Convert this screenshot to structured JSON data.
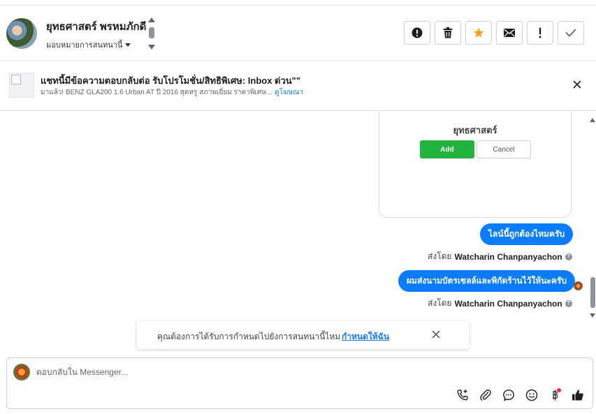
{
  "header": {
    "contact_name": "ยุทธศาสตร์ พรหมภักดี",
    "assign_label": "มอบหมายการสนทนานี้",
    "action_buttons": [
      {
        "name": "spam-button",
        "icon": "alert-circle-icon"
      },
      {
        "name": "delete-button",
        "icon": "trash-icon"
      },
      {
        "name": "star-button",
        "icon": "star-icon"
      },
      {
        "name": "mark-unread-button",
        "icon": "envelope-icon"
      },
      {
        "name": "follow-up-button",
        "icon": "exclamation-icon"
      },
      {
        "name": "done-button",
        "icon": "check-icon"
      }
    ]
  },
  "banner": {
    "title": "แชทนี้มีข้อความตอบกลับต่อ รับโปรโมชั่น/สิทธิพิเศษ: Inbox ด่วน\"\"",
    "subtitle": "มาแล้ว! BENZ GLA200 1.6 Urban AT ปี 2016 สุดหรู สภาพเยี่ยม ราคาพิเศษ...",
    "link": "ดูโฆษณา"
  },
  "card": {
    "name": "ยุทธศาสตร์",
    "add_label": "Add",
    "cancel_label": "Cancel"
  },
  "messages": [
    {
      "text": "ไลน์นี้ถูกต้องไหมครับ",
      "sent_prefix": "ส่งโดย",
      "sender": "Watcharin Chanpanyachon"
    },
    {
      "text": "ผมส่งนามบัตรเซลล์และพิกัดร้านไว้ให้นะครับ",
      "sent_prefix": "ส่งโดย",
      "sender": "Watcharin Chanpanyachon"
    }
  ],
  "toast": {
    "text": "คุณต้องการได้รับการกำหนดไปยังการสนทนานี้ไหม",
    "link": "กำหนดให้ฉัน"
  },
  "composer": {
    "placeholder": "ตอบกลับใน Messenger...",
    "tools": [
      "call-add-icon",
      "paperclip-icon",
      "chat-bubble-icon",
      "smiley-icon",
      "baht-icon",
      "thumbs-up-icon"
    ]
  },
  "colors": {
    "bubble": "#0a7cff",
    "add_button": "#21b33e",
    "star": "#f7a21b",
    "link": "#1877f2"
  }
}
